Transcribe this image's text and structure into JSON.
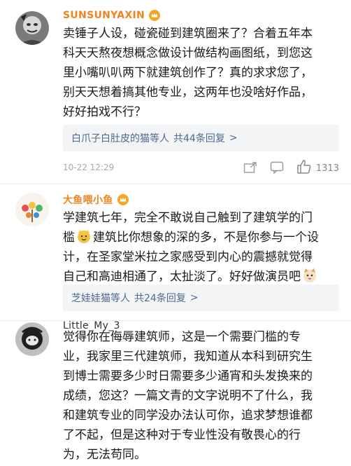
{
  "comments": [
    {
      "username": "SUNSUNYAXIN",
      "lines": [
        "卖锤子人设，碰瓷碰到建筑圈来了？合着五年本",
        "科天天熬夜想概念做设计做结构画图纸，到您这",
        "里小嘴叭叭两下就建筑创作了？真的求求您了，",
        "别天天想着搞其他专业，这两年也没啥好作品，",
        "好好拍戏不行？"
      ],
      "reply_names": "白爪子白肚皮的猫等人",
      "reply_count": "共44条回复",
      "reply_arrow": ">",
      "time": "10-22 12:29",
      "likes": "1313"
    },
    {
      "username": "大鱼喂小鱼",
      "line1": "学建筑七年，完全不敢说自己触到了建筑学的门",
      "line2a": "槛",
      "line2b": "建筑比你想象的深的多，不是你参与一个设",
      "line3": "计，在圣家堂米拉之家感受到内心的震撼就觉得",
      "line4": "自己和高迪相通了，太扯淡了。好好做演员吧",
      "reply_names": "芝娃娃猫等人",
      "reply_count": "共24条回复",
      "reply_arrow": ">"
    },
    {
      "username": "Little_My_3",
      "lines": [
        "觉得你在侮辱建筑师，这是一个需要门槛的专",
        "业，我家里三代建筑师，我知道从本科到研究生",
        "到博士需要多少时日需要多少通宵和头发换来的",
        "成绩，您这？一篇文青的文字说明不了什么，我",
        "和建筑专业的同学没办法认可你，追求梦想谁都",
        "了不起，但是这种对于专业性没有敬畏心的行",
        "为，无法苟同。"
      ]
    }
  ],
  "icons": {
    "vip": "vip-crown-icon",
    "share": "share-icon",
    "comment": "comment-icon",
    "like": "thumbs-up-icon"
  },
  "colors": {
    "username_vip": "#f0831f",
    "reply_link": "#4d6a8f",
    "reply_bg": "#f3f4f6"
  }
}
